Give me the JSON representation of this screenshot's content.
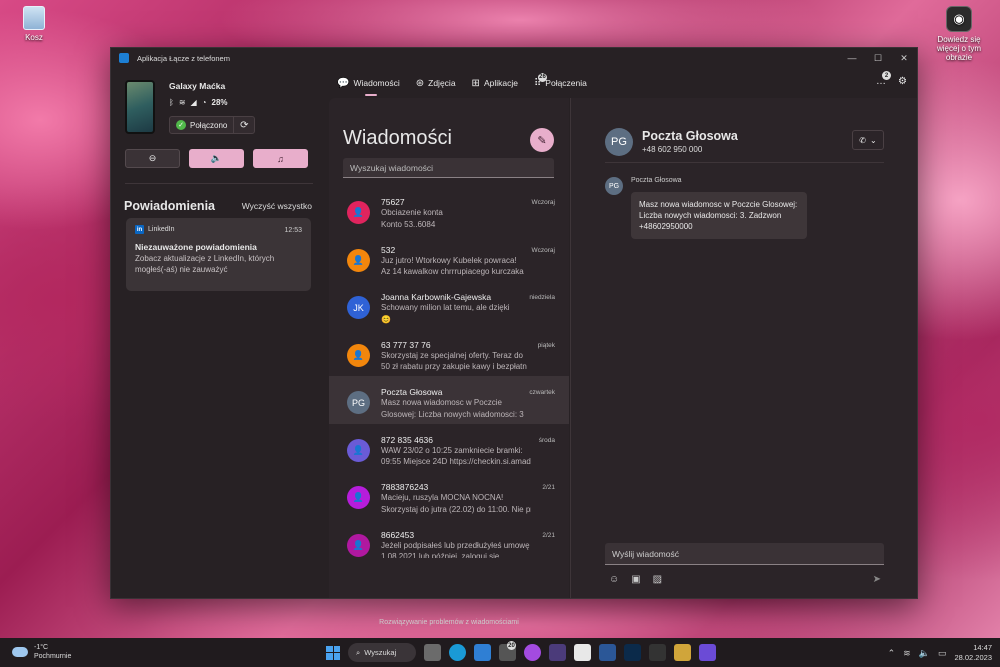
{
  "desktop": {
    "recycle_label": "Kosz",
    "camera_label": "Dowiedz się więcej o tym obrazie"
  },
  "window": {
    "title": "Aplikacja Łącze z telefonem",
    "controls": [
      "—",
      "☐",
      "✕"
    ]
  },
  "device": {
    "name": "Galaxy Maćka",
    "battery": "28%",
    "status": "Połączono"
  },
  "nav": {
    "tabs": [
      {
        "label": "Wiadomości",
        "icon": "chat-icon",
        "glyph": "💬"
      },
      {
        "label": "Zdjęcia",
        "icon": "photos-icon",
        "glyph": "⊛"
      },
      {
        "label": "Aplikacje",
        "icon": "apps-icon",
        "glyph": "⊞"
      },
      {
        "label": "Połączenia",
        "icon": "dialpad-icon",
        "glyph": "⠿"
      }
    ],
    "calls_badge": "26",
    "notifications_badge": "2"
  },
  "notifications": {
    "title": "Powiadomienia",
    "clear_all": "Wyczyść wszystko",
    "card": {
      "app": "LinkedIn",
      "time": "12:53",
      "heading": "Niezauważone powiadomienia",
      "body": "Zobacz aktualizacje z LinkedIn, których mogłeś(-aś) nie zauważyć"
    }
  },
  "messages": {
    "title": "Wiadomości",
    "search_placeholder": "Wyszukaj wiadomości",
    "troubleshoot": "Rozwiązywanie problemów z wiadomościami",
    "conversations": [
      {
        "name": "75627",
        "date": "Wczoraj",
        "preview1": "Obciazenie konta",
        "preview2": "Konto 53..6084",
        "initials": "",
        "color": "#e0245e"
      },
      {
        "name": "532",
        "date": "Wczoraj",
        "preview1": "Juz jutro! Wtorkowy Kubelek powraca!",
        "preview2": "Az 14 kawalkow chrrrupiacego kurczaka",
        "initials": "",
        "color": "#f2860c"
      },
      {
        "name": "Joanna Karbownik-Gajewska",
        "date": "niedziela",
        "preview1": "Schowany milion lat temu, ale dzięki",
        "preview2": "😊",
        "initials": "JK",
        "color": "#2f62d6"
      },
      {
        "name": "63 777 37 76",
        "date": "piątek",
        "preview1": "Skorzystaj ze specjalnej oferty. Teraz do",
        "preview2": "50 zł rabatu przy zakupie kawy i bezpłatn",
        "initials": "",
        "color": "#f2860c"
      },
      {
        "name": "Poczta Głosowa",
        "date": "czwartek",
        "preview1": "Masz nowa wiadomosc w Poczcie",
        "preview2": "Glosowej: Liczba nowych wiadomosci: 3",
        "initials": "PG",
        "color": "#5d6e82"
      },
      {
        "name": "872 835 4636",
        "date": "środa",
        "preview1": "WAW 23/02 o 10:25 zamkniecie bramki:",
        "preview2": "09:55 Miejsce 24D https://checkin.si.amad",
        "initials": "",
        "color": "#6a5bd6"
      },
      {
        "name": "7883876243",
        "date": "2/21",
        "preview1": "Macieju, ruszyla MOCNA NOCNA!",
        "preview2": "Skorzystaj do jutra (22.02) do 11:00. Nie pr.",
        "initials": "",
        "color": "#b61ddb"
      },
      {
        "name": "8662453",
        "date": "2/21",
        "preview1": "Jeżeli podpisałeś lub przedłużyłeś umowę",
        "preview2": "1.08.2021 lub później, zaloguj się",
        "initials": "",
        "color": "#b018a0"
      }
    ]
  },
  "conversation": {
    "initials": "PG",
    "name": "Poczta Głosowa",
    "number": "+48 602 950 000",
    "sender": "Poczta Głosowa",
    "message": "Masz nowa wiadomosc w Poczcie Glosowej: Liczba nowych wiadomosci: 3. Zadzwon +48602950000",
    "reply_placeholder": "Wyślij wiadomość"
  },
  "taskbar": {
    "temp": "-1°C",
    "weather": "Pochmurnie",
    "search": "Wyszukaj",
    "time": "14:47",
    "date": "28.02.2023",
    "app_badge": "20"
  }
}
